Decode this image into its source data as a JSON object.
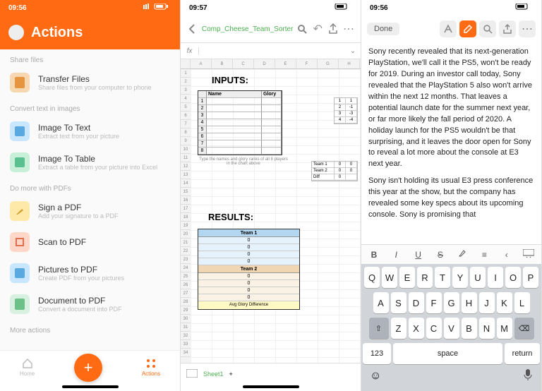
{
  "screen1": {
    "time": "09:56",
    "title": "Actions",
    "sections": [
      {
        "label": "Share files",
        "items": [
          {
            "icon": "doc",
            "color": "#f6d7b0",
            "title": "Transfer Files",
            "subtitle": "Share files from your computer to phone"
          }
        ]
      },
      {
        "label": "Convert text in images",
        "items": [
          {
            "icon": "img",
            "color": "#c8e6ff",
            "title": "Image To Text",
            "subtitle": "Extract text from your picture"
          },
          {
            "icon": "img",
            "color": "#c8f0d8",
            "title": "Image To Table",
            "subtitle": "Extract a table from your picture into Excel"
          }
        ]
      },
      {
        "label": "Do more with PDFs",
        "items": [
          {
            "icon": "pen",
            "color": "#ffe9a8",
            "title": "Sign a PDF",
            "subtitle": "Add your signature to a PDF"
          },
          {
            "icon": "scan",
            "color": "#ffd7c8",
            "title": "Scan to PDF",
            "subtitle": ""
          },
          {
            "icon": "pic",
            "color": "#c8e6ff",
            "title": "Pictures to PDF",
            "subtitle": "Create PDF from your pictures"
          },
          {
            "icon": "doc",
            "color": "#d8f0e0",
            "title": "Document to PDF",
            "subtitle": "Convert a document into PDF"
          }
        ]
      },
      {
        "label": "More actions",
        "items": []
      }
    ],
    "tabs": {
      "home": "Home",
      "actions": "Actions"
    }
  },
  "screen2": {
    "time": "09:57",
    "filename": "Comp_Cheese_Team_Sorter",
    "fx": "fx",
    "cols": [
      "A",
      "B",
      "C",
      "D",
      "E",
      "F",
      "G",
      "H"
    ],
    "inputs_title": "INPUTS:",
    "input_headers": {
      "name": "Name",
      "glory": "Glory"
    },
    "input_rows": [
      "1",
      "2",
      "3",
      "4",
      "5",
      "6",
      "7",
      "8"
    ],
    "tip": "Type the names and glory ranks of all 8 players in the chart above",
    "mini1_rows": [
      [
        "1",
        "1"
      ],
      [
        "2",
        "-1"
      ],
      [
        "3",
        "-3"
      ],
      [
        "4",
        "-4"
      ]
    ],
    "mini2": {
      "labels": [
        "Team 1",
        "Team 2",
        "Diff"
      ],
      "vals": [
        [
          "0",
          "0"
        ],
        [
          "0",
          "0"
        ],
        [
          "0",
          ""
        ]
      ]
    },
    "results_title": "RESULTS:",
    "team1": "Team 1",
    "team2": "Team 2",
    "team_vals": [
      "0",
      "0",
      "0",
      "0"
    ],
    "agd": "Avg Glory Difference",
    "sheet_tab": "Sheet1"
  },
  "screen3": {
    "time": "09:56",
    "done": "Done",
    "para1": "Sony recently revealed that its next-generation PlayStation, we'll call it the PS5, won't be ready for 2019. During an investor call today, Sony revealed that the PlayStation 5 also won't arrive within the next 12 months. That leaves a potential launch date for the summer next year, or far more likely the fall period of 2020. A holiday launch for the PS5 wouldn't be that surprising, and it leaves the door open for Sony to reveal a lot more about the console at E3 next year.",
    "para2": "Sony isn't holding its usual E3 press conference this year at the show, but the company has revealed some key specs about its upcoming console. Sony is promising that",
    "fmt": {
      "bold": "B",
      "italic": "I",
      "under": "U",
      "strike": "S"
    },
    "keyboard": {
      "row1": [
        "Q",
        "W",
        "E",
        "R",
        "T",
        "Y",
        "U",
        "I",
        "O",
        "P"
      ],
      "row2": [
        "A",
        "S",
        "D",
        "F",
        "G",
        "H",
        "J",
        "K",
        "L"
      ],
      "row3": [
        "Z",
        "X",
        "C",
        "V",
        "B",
        "N",
        "M"
      ],
      "num": "123",
      "space": "space",
      "return": "return"
    }
  }
}
